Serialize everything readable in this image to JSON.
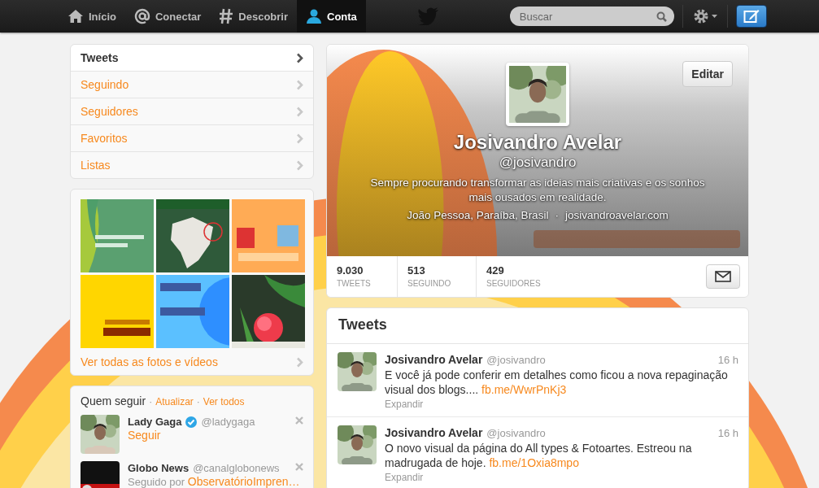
{
  "topbar": {
    "nav": [
      {
        "label": "Início",
        "selected": false
      },
      {
        "label": "Conectar",
        "selected": false
      },
      {
        "label": "Descobrir",
        "selected": false
      },
      {
        "label": "Conta",
        "selected": true
      }
    ],
    "search": {
      "placeholder": "Buscar"
    }
  },
  "sidebar": {
    "items": [
      {
        "label": "Tweets",
        "selected": true
      },
      {
        "label": "Seguindo",
        "selected": false
      },
      {
        "label": "Seguidores",
        "selected": false
      },
      {
        "label": "Favoritos",
        "selected": false
      },
      {
        "label": "Listas",
        "selected": false
      }
    ]
  },
  "media": {
    "link": "Ver todas as fotos e vídeos"
  },
  "who_to_follow": {
    "title": "Quem seguir",
    "actions": [
      {
        "separator": "·",
        "label": "Atualizar"
      },
      {
        "separator": "·",
        "label": "Ver todos"
      }
    ],
    "suggestions": [
      {
        "kind": "follow",
        "name": "Lady Gaga",
        "verified": true,
        "handle": "@ladygaga",
        "action": "Seguir"
      },
      {
        "kind": "followed_by",
        "name": "Globo News",
        "verified": false,
        "handle": "@canalglobonews",
        "prefix": "Seguido por",
        "action": "ObservatórioImpren…"
      }
    ]
  },
  "profile": {
    "name": "Josivandro Avelar",
    "handle": "@josivandro",
    "bio": "Sempre procurando transformar as ideias mais criativas e os sonhos mais ousados em realidade.",
    "location": "João Pessoa, Paraíba, Brasil",
    "separator": "·",
    "website": "josivandroavelar.com",
    "edit_button": "Editar",
    "stats": [
      {
        "value": "9.030",
        "label": "TWEETS"
      },
      {
        "value": "513",
        "label": "SEGUINDO"
      },
      {
        "value": "429",
        "label": "SEGUIDORES"
      }
    ]
  },
  "tweets": {
    "title": "Tweets",
    "items": [
      {
        "name": "Josivandro Avelar",
        "handle": "@josivandro",
        "time": "16 h",
        "text": "E você já pode conferir em detalhes como ficou a nova repaginação visual dos blogs....",
        "link": "fb.me/WwrPnKj3",
        "expand": "Expandir"
      },
      {
        "name": "Josivandro Avelar",
        "handle": "@josivandro",
        "time": "16 h",
        "text": "O novo visual da página do All types & Fotoartes. Estreou na madrugada de hoje.",
        "link": "fb.me/1Oxia8mpo",
        "expand": "Expandir"
      }
    ]
  }
}
